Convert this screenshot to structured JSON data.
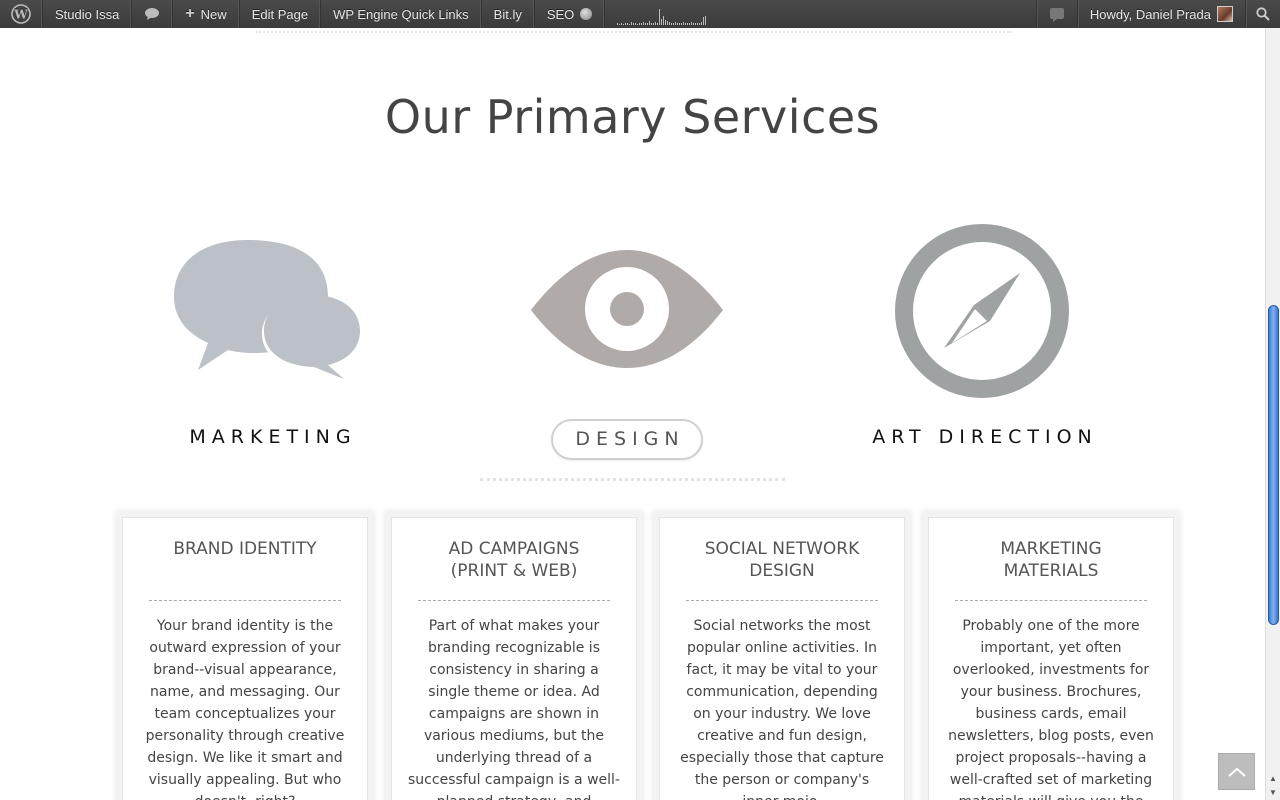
{
  "admin_bar": {
    "site_name": "Studio Issa",
    "new_label": "New",
    "new_plus": "+",
    "edit_page": "Edit Page",
    "quick_links": "WP Engine Quick Links",
    "bitly": "Bit.ly",
    "seo": "SEO",
    "greeting": "Howdy, Daniel Prada"
  },
  "services": {
    "title": "Our Primary Services",
    "items": [
      {
        "label": "MARKETING",
        "icon": "speech-bubbles-icon",
        "color": "#bcc1c8"
      },
      {
        "label": "DESIGN",
        "icon": "eye-icon",
        "color": "#b0aba8",
        "active": true
      },
      {
        "label": "ART DIRECTION",
        "icon": "compass-icon",
        "color": "#9ea2a2"
      }
    ]
  },
  "cards": [
    {
      "title": "BRAND IDENTITY",
      "body": "Your brand identity is the outward expression of your brand--visual appearance, name, and messaging. Our team conceptualizes your personality through creative design. We like it smart and visually appealing. But who doesn't, right?"
    },
    {
      "title": "AD CAMPAIGNS\n(PRINT & WEB)",
      "body": "Part of what makes your branding recognizable is consistency in sharing a single theme or idea. Ad campaigns are shown in various mediums, but the underlying thread of a successful campaign is a well-planned strategy, and perhaps a little luck."
    },
    {
      "title": "SOCIAL NETWORK\nDESIGN",
      "body": "Social networks the most popular online activities. In fact, it may be vital to your communication, depending on your industry. We love creative and fun design, especially those that capture the person or company's inner mojo."
    },
    {
      "title": "MARKETING\nMATERIALS",
      "body": "Probably one of the more important, yet often overlooked, investments for your business. Brochures, business cards, email newsletters, blog posts, even project proposals--having a well-crafted set of marketing materials will give you the"
    }
  ],
  "colors": {
    "adminbar": "#464646",
    "title": "#444444",
    "scroll_thumb": "#4f8ae0"
  },
  "back_to_top_icon": "chevron-up-icon"
}
